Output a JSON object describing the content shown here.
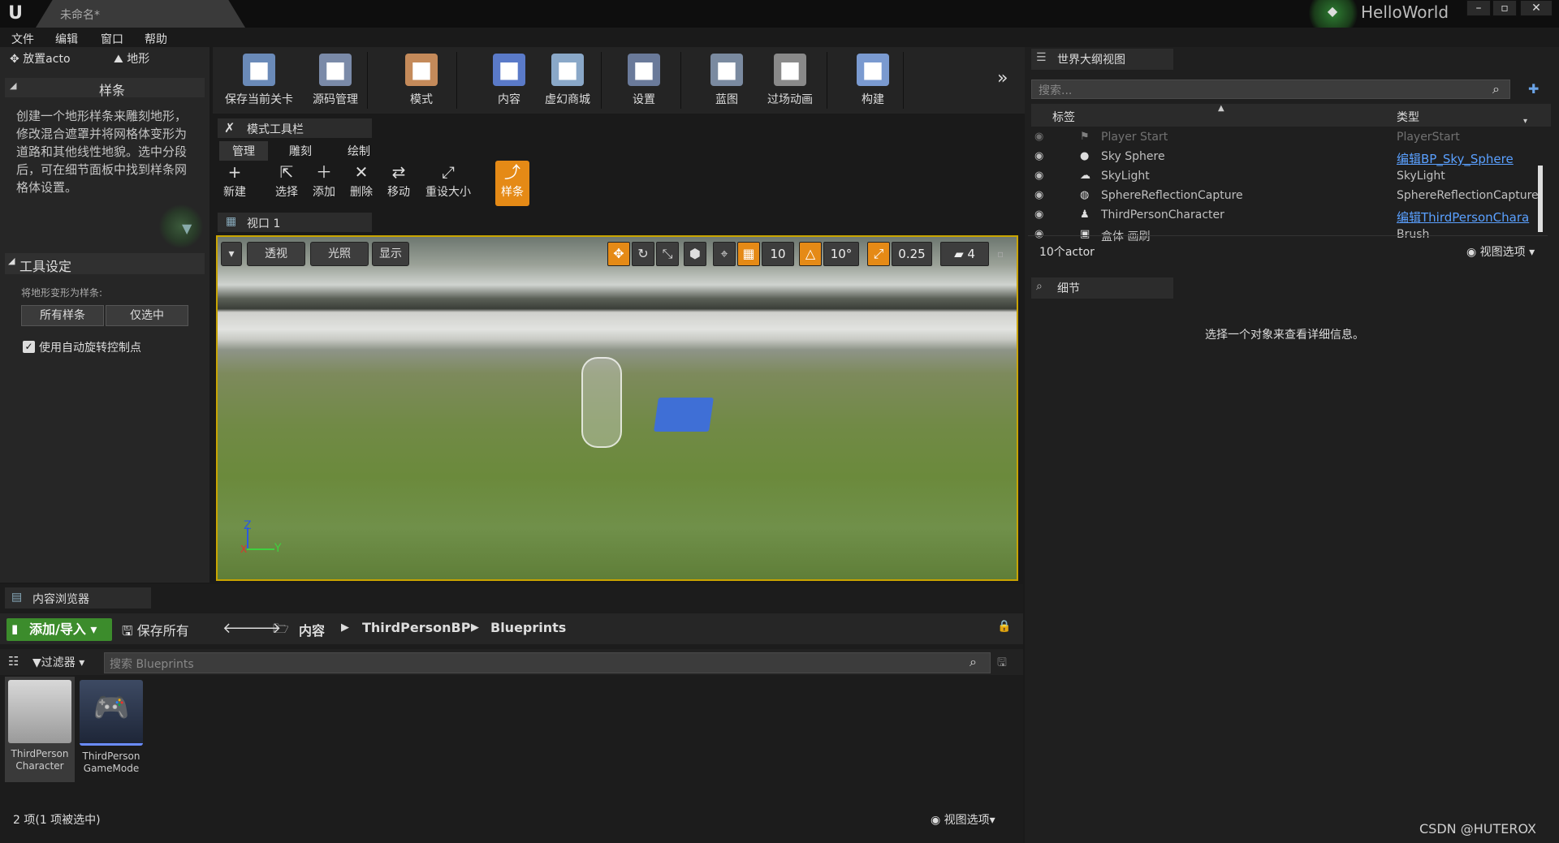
{
  "app": {
    "doc_tab": "未命名*",
    "project": "HelloWorld"
  },
  "menu": [
    "文件",
    "编辑",
    "窗口",
    "帮助"
  ],
  "left_panel": {
    "tabs": [
      "放置acto",
      "地形"
    ],
    "header": "样条",
    "description": "创建一个地形样条来雕刻地形，修改混合遮罩并将网格体变形为道路和其他线性地貌。选中分段后，可在细节面板中找到样条网格体设置。",
    "tool_settings": "工具设定",
    "convert_label": "将地形变形为样条:",
    "btn_all": "所有样条",
    "btn_selected": "仅选中",
    "checkbox_label": "使用自动旋转控制点"
  },
  "toolbar": [
    {
      "label": "保存当前关卡",
      "icon": "save-icon",
      "color": "#6a8ab8"
    },
    {
      "label": "源码管理",
      "icon": "source-control-icon",
      "color": "#7a8aa8"
    },
    {
      "label": "模式",
      "icon": "modes-icon",
      "color": "#c48a5a"
    },
    {
      "label": "内容",
      "icon": "content-icon",
      "color": "#5a7ac8"
    },
    {
      "label": "虚幻商城",
      "icon": "marketplace-icon",
      "color": "#8aa8c8"
    },
    {
      "label": "设置",
      "icon": "settings-icon",
      "color": "#6a7a9a"
    },
    {
      "label": "蓝图",
      "icon": "blueprint-icon",
      "color": "#7a8aa0"
    },
    {
      "label": "过场动画",
      "icon": "cinematics-icon",
      "color": "#8a8a8a"
    },
    {
      "label": "构建",
      "icon": "build-icon",
      "color": "#7a9ad0"
    }
  ],
  "modes": {
    "title": "模式工具栏",
    "subtabs": [
      "管理",
      "雕刻",
      "绘制"
    ],
    "tools": [
      {
        "label": "新建",
        "icon": "+"
      },
      {
        "label": "选择",
        "icon": "⇱"
      },
      {
        "label": "添加",
        "icon": "＋"
      },
      {
        "label": "删除",
        "icon": "✕"
      },
      {
        "label": "移动",
        "icon": "⇄"
      },
      {
        "label": "重设大小",
        "icon": "⤢"
      }
    ],
    "active": "样条"
  },
  "viewport": {
    "title": "视口 1",
    "perspective": "透视",
    "lit": "光照",
    "show": "显示",
    "grid_snap": "10",
    "rot_snap": "10°",
    "scale_snap": "0.25",
    "cam_speed": "4",
    "axis": {
      "z": "Z",
      "y": "Y",
      "x": "X"
    }
  },
  "outliner": {
    "title": "世界大纲视图",
    "search_placeholder": "搜索...",
    "col_label": "标签",
    "col_type": "类型",
    "rows": [
      {
        "name": "Player Start",
        "type": "PlayerStart",
        "link": false
      },
      {
        "name": "Sky Sphere",
        "type": "编辑BP_Sky_Sphere",
        "link": true
      },
      {
        "name": "SkyLight",
        "type": "SkyLight",
        "link": false
      },
      {
        "name": "SphereReflectionCapture",
        "type": "SphereReflectionCapture",
        "link": false
      },
      {
        "name": "ThirdPersonCharacter",
        "type": "编辑ThirdPersonChara",
        "link": true
      },
      {
        "name": "盒体 画刷",
        "type": "Brush",
        "link": false
      }
    ],
    "count": "10个actor",
    "view_options": "视图选项"
  },
  "details": {
    "title": "细节",
    "empty": "选择一个对象来查看详细信息。"
  },
  "content_browser": {
    "title": "内容浏览器",
    "add": "添加/导入",
    "save_all": "保存所有",
    "crumbs": [
      "内容",
      "ThirdPersonBP",
      "Blueprints"
    ],
    "filter": "过滤器",
    "search_placeholder": "搜索 Blueprints",
    "assets": [
      {
        "line1": "ThirdPerson",
        "line2": "Character"
      },
      {
        "line1": "ThirdPerson",
        "line2": "GameMode"
      }
    ],
    "status": "2 项(1 项被选中)",
    "view_options": "视图选项"
  },
  "watermark": "CSDN @HUTEROX"
}
